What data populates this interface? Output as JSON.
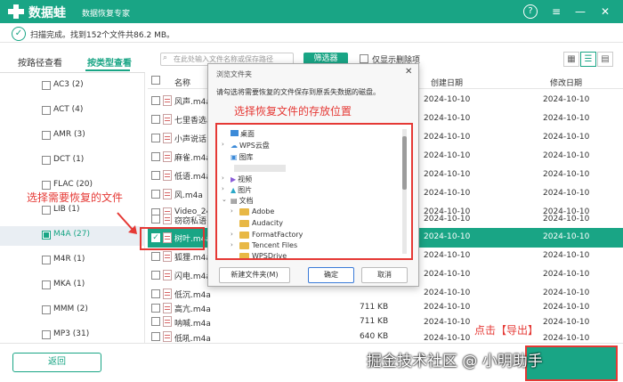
{
  "app": {
    "title": "数据蛙",
    "subtitle": "数据恢复专家"
  },
  "toolbar": {
    "help_icon": "?",
    "menu_icon": "≡",
    "min_icon": "—",
    "close_icon": "✕"
  },
  "status": {
    "text": "扫描完成。找到152个文件共86.2 MB。"
  },
  "tabs": [
    {
      "label": "按路径查看"
    },
    {
      "label": "按类型查看"
    }
  ],
  "tree": [
    {
      "label": "AC3 (2)"
    },
    {
      "label": "ACT (4)"
    },
    {
      "label": "AMR (3)"
    },
    {
      "label": "DCT (1)"
    },
    {
      "label": "FLAC (20)"
    },
    {
      "label": "LIB (1)"
    },
    {
      "label": "M4A (27)"
    },
    {
      "label": "M4R (1)"
    },
    {
      "label": "MKA (1)"
    },
    {
      "label": "MMM (2)"
    },
    {
      "label": "MP3 (31)"
    }
  ],
  "annotations": {
    "left": "选择需要恢复的文件",
    "dialog": "选择恢复文件的存放位置",
    "export": "点击【导出】"
  },
  "search": {
    "placeholder": "在此处输入文件名称或保存路径"
  },
  "filter_label": "筛选器",
  "only_deleted": "仅显示删除项",
  "table": {
    "headers": [
      "名称",
      "创建日期",
      "修改日期"
    ],
    "rows": [
      {
        "name": "风声.m4a",
        "size": "",
        "created": "2024-10-10",
        "modified": "2024-10-10"
      },
      {
        "name": "七里香选段",
        "size": "",
        "created": "2024-10-10",
        "modified": "2024-10-10"
      },
      {
        "name": "小声说话.m",
        "size": "",
        "created": "2024-10-10",
        "modified": "2024-10-10"
      },
      {
        "name": "麻雀.m4a",
        "size": "",
        "created": "2024-10-10",
        "modified": "2024-10-10"
      },
      {
        "name": "低语.m4a",
        "size": "",
        "created": "2024-10-10",
        "modified": "2024-10-10"
      },
      {
        "name": "风.m4a",
        "size": "",
        "created": "2024-10-10",
        "modified": "2024-10-10"
      },
      {
        "name": "Video_240",
        "size": "",
        "created": "2024-10-10",
        "modified": "2024-10-10"
      },
      {
        "name": "窃窃私语.n",
        "size": "",
        "created": "2024-10-10",
        "modified": "2024-10-10"
      },
      {
        "name": "树叶.m4a",
        "size": "",
        "created": "2024-10-10",
        "modified": "2024-10-10"
      },
      {
        "name": "狐狸.m4a",
        "size": "",
        "created": "2024-10-10",
        "modified": "2024-10-10"
      },
      {
        "name": "闪电.m4a",
        "size": "",
        "created": "2024-10-10",
        "modified": "2024-10-10"
      },
      {
        "name": "低沉.m4a",
        "size": "",
        "created": "2024-10-10",
        "modified": "2024-10-10"
      },
      {
        "name": "高亢.m4a",
        "size": "711 KB",
        "created": "2024-10-10",
        "modified": "2024-10-10"
      },
      {
        "name": "呐喊.m4a",
        "size": "711 KB",
        "created": "2024-10-10",
        "modified": "2024-10-10"
      },
      {
        "name": "低吼.m4a",
        "size": "640 KB",
        "created": "2024-10-10",
        "modified": "2024-10-10"
      }
    ]
  },
  "dialog": {
    "title": "浏览文件夹",
    "message": "请勾选将需要恢复的文件保存到原丢失数据的磁盘。",
    "tree": [
      "桌面",
      "WPS云盘",
      "图库",
      "视频",
      "图片",
      "文档",
      "Adobe",
      "Audacity",
      "FormatFactory",
      "Tencent Files",
      "WPSDrive"
    ],
    "new_folder": "新建文件夹(M)",
    "ok": "确定",
    "cancel": "取消"
  },
  "bottom": {
    "back": "返回"
  },
  "watermark": "掘金技术社区 @ 小明助手"
}
